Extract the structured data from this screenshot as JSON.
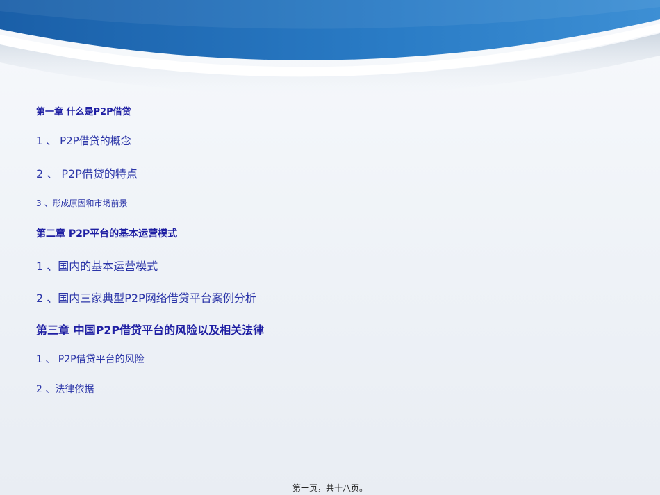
{
  "colors": {
    "banner_dark": "#1a5fa8",
    "banner_light": "#3d8fd4",
    "text_blue": "#2b35a8",
    "chapter_blue": "#1f1fa3"
  },
  "toc": {
    "chapter1": {
      "title": "第一章 什么是P2P借贷"
    },
    "chapter1_items": [
      "1 、 P2P借贷的概念",
      "2 、 P2P借贷的特点",
      "3 、形成原因和市场前景"
    ],
    "chapter2": {
      "title": "第二章  P2P平台的基本运营模式"
    },
    "chapter2_items": [
      "1 、国内的基本运营模式",
      "2 、国内三家典型P2P网络借贷平台案例分析"
    ],
    "chapter3": {
      "title": "第三章  中国P2P借贷平台的风险以及相关法律"
    },
    "chapter3_items": [
      "1 、 P2P借贷平台的风险",
      "2 、法律依据"
    ]
  },
  "footer": {
    "page_label": "第一页，共十八页。"
  }
}
